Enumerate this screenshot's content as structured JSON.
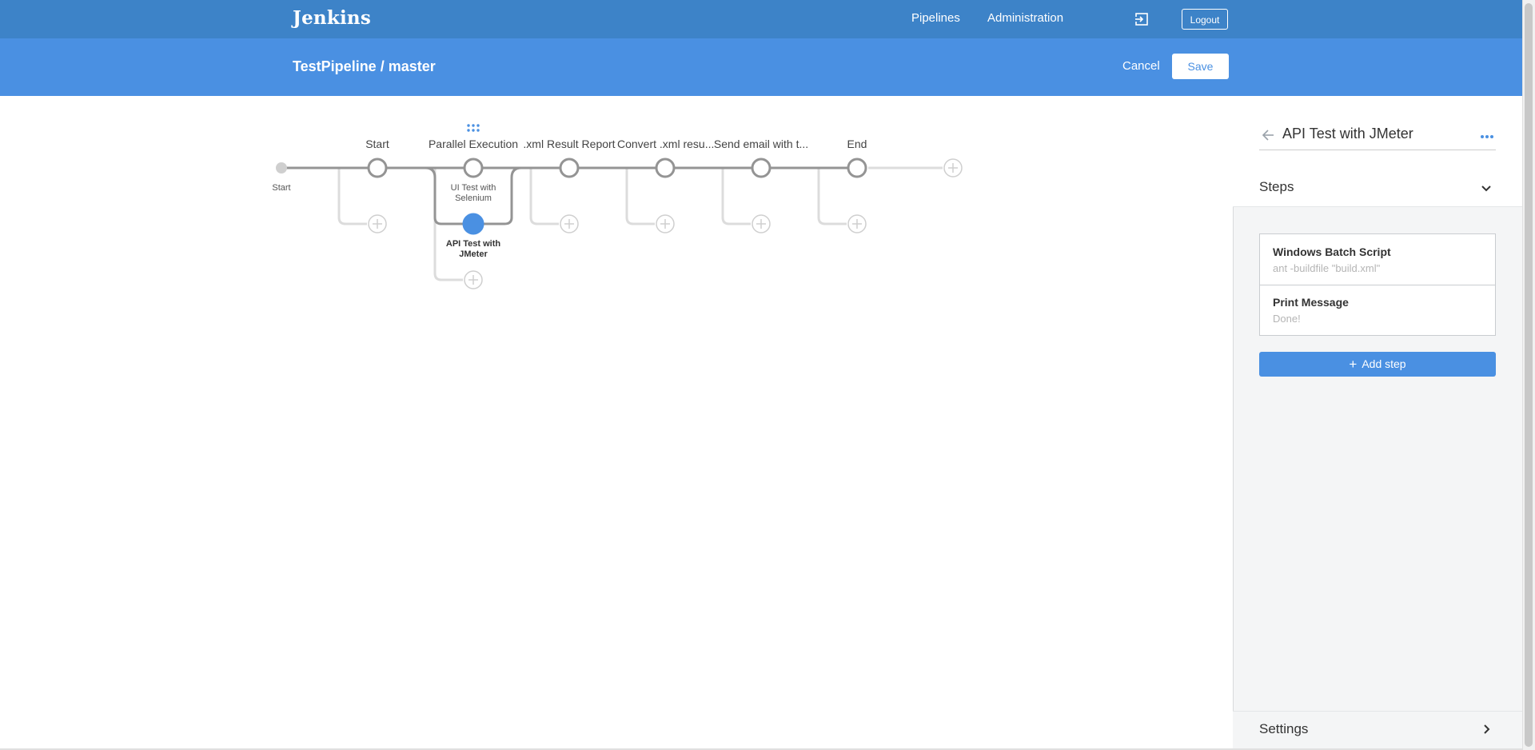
{
  "header": {
    "logo": "Jenkins",
    "nav": [
      "Pipelines",
      "Administration"
    ],
    "exit_icon": "exit-icon",
    "logout_label": "Logout"
  },
  "subheader": {
    "breadcrumb": "TestPipeline / master",
    "cancel_label": "Cancel",
    "save_label": "Save"
  },
  "pipeline": {
    "start_label": "Start",
    "stages": [
      "Start",
      "Parallel Execution",
      ".xml Result Report",
      "Convert .xml resu...",
      "Send email with t...",
      "End"
    ],
    "parallel_branches": [
      "UI Test with Selenium",
      "API Test with JMeter"
    ],
    "selected_branch": "API Test with JMeter",
    "grip_icon": "grip-dots-icon",
    "add_icon": "plus-circle-icon"
  },
  "side_panel": {
    "title": "API Test with JMeter",
    "back_icon": "arrow-left-icon",
    "more_icon": "more-dots-icon",
    "steps_label": "Steps",
    "steps": [
      {
        "title": "Windows Batch Script",
        "detail": "ant -buildfile \"build.xml\""
      },
      {
        "title": "Print Message",
        "detail": "Done!"
      }
    ],
    "add_step_label": "Add step",
    "settings_label": "Settings"
  },
  "colors": {
    "topbar": "#3d83c8",
    "subbar": "#4a90e2",
    "accent": "#4a90e2",
    "node_stroke": "#949494",
    "connector_light": "#dcdcdc"
  }
}
